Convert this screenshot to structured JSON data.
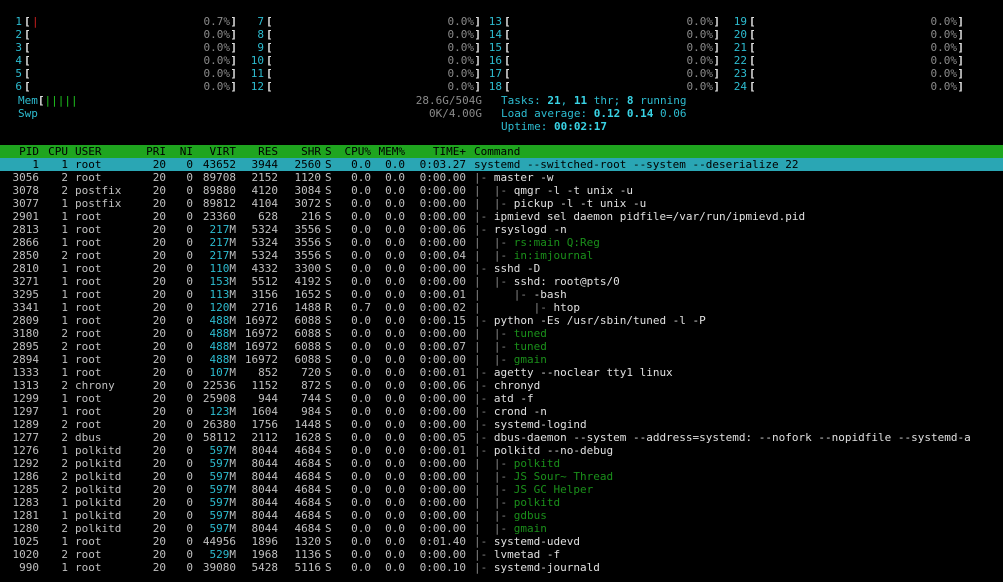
{
  "cpus": [
    {
      "n": "1",
      "bar": "|",
      "pct": "0.7%"
    },
    {
      "n": "2",
      "bar": "",
      "pct": "0.0%"
    },
    {
      "n": "3",
      "bar": "",
      "pct": "0.0%"
    },
    {
      "n": "4",
      "bar": "",
      "pct": "0.0%"
    },
    {
      "n": "5",
      "bar": "",
      "pct": "0.0%"
    },
    {
      "n": "6",
      "bar": "",
      "pct": "0.0%"
    },
    {
      "n": "7",
      "bar": "",
      "pct": "0.0%"
    },
    {
      "n": "8",
      "bar": "",
      "pct": "0.0%"
    },
    {
      "n": "9",
      "bar": "",
      "pct": "0.0%"
    },
    {
      "n": "10",
      "bar": "",
      "pct": "0.0%"
    },
    {
      "n": "11",
      "bar": "",
      "pct": "0.0%"
    },
    {
      "n": "12",
      "bar": "",
      "pct": "0.0%"
    },
    {
      "n": "13",
      "bar": "",
      "pct": "0.0%"
    },
    {
      "n": "14",
      "bar": "",
      "pct": "0.0%"
    },
    {
      "n": "15",
      "bar": "",
      "pct": "0.0%"
    },
    {
      "n": "16",
      "bar": "",
      "pct": "0.0%"
    },
    {
      "n": "17",
      "bar": "",
      "pct": "0.0%"
    },
    {
      "n": "18",
      "bar": "",
      "pct": "0.0%"
    },
    {
      "n": "19",
      "bar": "",
      "pct": "0.0%"
    },
    {
      "n": "20",
      "bar": "",
      "pct": "0.0%"
    },
    {
      "n": "21",
      "bar": "",
      "pct": "0.0%"
    },
    {
      "n": "22",
      "bar": "",
      "pct": "0.0%"
    },
    {
      "n": "23",
      "bar": "",
      "pct": "0.0%"
    },
    {
      "n": "24",
      "bar": "",
      "pct": "0.0%"
    }
  ],
  "mem": {
    "label": "Mem",
    "bars": "|||||",
    "value": "28.6G/504G"
  },
  "swp": {
    "label": "Swp",
    "value": "0K/4.00G"
  },
  "tasks": {
    "label": "Tasks:",
    "count": "21",
    "sep": ",",
    "threads": "11",
    "thr_label": "thr;",
    "running": "8",
    "running_label": "running"
  },
  "load": {
    "label": "Load average:",
    "v1": "0.12",
    "v2": "0.14",
    "v3": "0.06"
  },
  "uptime": {
    "label": "Uptime:",
    "value": "00:02:17"
  },
  "columns": [
    "PID",
    "CPU",
    "USER",
    "PRI",
    "NI",
    "VIRT",
    "RES",
    "SHR",
    "S",
    "CPU%",
    "MEM%",
    "TIME+",
    "Command"
  ],
  "processes": [
    {
      "pid": "1",
      "cpu": "1",
      "user": "root",
      "pri": "20",
      "ni": "0",
      "virt": "43652",
      "res": "3944",
      "shr": "2560",
      "s": "S",
      "cpup": "0.0",
      "memp": "0.0",
      "time": "0:03.27",
      "tree": "",
      "cmd": "systemd --switched-root --system --deserialize 22",
      "selected": true
    },
    {
      "pid": "3056",
      "cpu": "2",
      "user": "root",
      "pri": "20",
      "ni": "0",
      "virt": "89708",
      "res": "2152",
      "shr": "1120",
      "s": "S",
      "cpup": "0.0",
      "memp": "0.0",
      "time": "0:00.00",
      "tree": "|- ",
      "cmd": "master -w",
      "thread": false
    },
    {
      "pid": "3078",
      "cpu": "2",
      "user": "postfix",
      "pri": "20",
      "ni": "0",
      "virt": "89880",
      "res": "4120",
      "shr": "3084",
      "s": "S",
      "cpup": "0.0",
      "memp": "0.0",
      "time": "0:00.00",
      "tree": "|  |- ",
      "cmd": "qmgr -l -t unix -u",
      "thread": false
    },
    {
      "pid": "3077",
      "cpu": "1",
      "user": "postfix",
      "pri": "20",
      "ni": "0",
      "virt": "89812",
      "res": "4104",
      "shr": "3072",
      "s": "S",
      "cpup": "0.0",
      "memp": "0.0",
      "time": "0:00.00",
      "tree": "|  |- ",
      "cmd": "pickup -l -t unix -u",
      "thread": false
    },
    {
      "pid": "2901",
      "cpu": "1",
      "user": "root",
      "pri": "20",
      "ni": "0",
      "virt": "23360",
      "res": "628",
      "shr": "216",
      "s": "S",
      "cpup": "0.0",
      "memp": "0.0",
      "time": "0:00.00",
      "tree": "|- ",
      "cmd": "ipmievd sel daemon pidfile=/var/run/ipmievd.pid",
      "thread": false
    },
    {
      "pid": "2813",
      "cpu": "1",
      "user": "root",
      "pri": "20",
      "ni": "0",
      "virt": "217M",
      "res": "5324",
      "shr": "3556",
      "s": "S",
      "cpup": "0.0",
      "memp": "0.0",
      "time": "0:00.06",
      "tree": "|- ",
      "cmd": "rsyslogd -n",
      "thread": false
    },
    {
      "pid": "2866",
      "cpu": "1",
      "user": "root",
      "pri": "20",
      "ni": "0",
      "virt": "217M",
      "res": "5324",
      "shr": "3556",
      "s": "S",
      "cpup": "0.0",
      "memp": "0.0",
      "time": "0:00.00",
      "tree": "|  |- ",
      "cmd": "rs:main Q:Reg",
      "thread": true
    },
    {
      "pid": "2850",
      "cpu": "2",
      "user": "root",
      "pri": "20",
      "ni": "0",
      "virt": "217M",
      "res": "5324",
      "shr": "3556",
      "s": "S",
      "cpup": "0.0",
      "memp": "0.0",
      "time": "0:00.04",
      "tree": "|  |- ",
      "cmd": "in:imjournal",
      "thread": true
    },
    {
      "pid": "2810",
      "cpu": "1",
      "user": "root",
      "pri": "20",
      "ni": "0",
      "virt": "110M",
      "res": "4332",
      "shr": "3300",
      "s": "S",
      "cpup": "0.0",
      "memp": "0.0",
      "time": "0:00.00",
      "tree": "|- ",
      "cmd": "sshd -D",
      "thread": false
    },
    {
      "pid": "3271",
      "cpu": "1",
      "user": "root",
      "pri": "20",
      "ni": "0",
      "virt": "153M",
      "res": "5512",
      "shr": "4192",
      "s": "S",
      "cpup": "0.0",
      "memp": "0.0",
      "time": "0:00.00",
      "tree": "|  |- ",
      "cmd": "sshd: root@pts/0",
      "thread": false
    },
    {
      "pid": "3295",
      "cpu": "1",
      "user": "root",
      "pri": "20",
      "ni": "0",
      "virt": "113M",
      "res": "3156",
      "shr": "1652",
      "s": "S",
      "cpup": "0.0",
      "memp": "0.0",
      "time": "0:00.01",
      "tree": "|     |- ",
      "cmd": "-bash",
      "thread": false
    },
    {
      "pid": "3341",
      "cpu": "1",
      "user": "root",
      "pri": "20",
      "ni": "0",
      "virt": "120M",
      "res": "2716",
      "shr": "1488",
      "s": "R",
      "cpup": "0.7",
      "memp": "0.0",
      "time": "0:00.02",
      "tree": "|        |- ",
      "cmd": "htop",
      "thread": false
    },
    {
      "pid": "2809",
      "cpu": "1",
      "user": "root",
      "pri": "20",
      "ni": "0",
      "virt": "488M",
      "res": "16972",
      "shr": "6088",
      "s": "S",
      "cpup": "0.0",
      "memp": "0.0",
      "time": "0:00.15",
      "tree": "|- ",
      "cmd": "python -Es /usr/sbin/tuned -l -P",
      "thread": false
    },
    {
      "pid": "3180",
      "cpu": "2",
      "user": "root",
      "pri": "20",
      "ni": "0",
      "virt": "488M",
      "res": "16972",
      "shr": "6088",
      "s": "S",
      "cpup": "0.0",
      "memp": "0.0",
      "time": "0:00.00",
      "tree": "|  |- ",
      "cmd": "tuned",
      "thread": true
    },
    {
      "pid": "2895",
      "cpu": "2",
      "user": "root",
      "pri": "20",
      "ni": "0",
      "virt": "488M",
      "res": "16972",
      "shr": "6088",
      "s": "S",
      "cpup": "0.0",
      "memp": "0.0",
      "time": "0:00.07",
      "tree": "|  |- ",
      "cmd": "tuned",
      "thread": true
    },
    {
      "pid": "2894",
      "cpu": "1",
      "user": "root",
      "pri": "20",
      "ni": "0",
      "virt": "488M",
      "res": "16972",
      "shr": "6088",
      "s": "S",
      "cpup": "0.0",
      "memp": "0.0",
      "time": "0:00.00",
      "tree": "|  |- ",
      "cmd": "gmain",
      "thread": true
    },
    {
      "pid": "1333",
      "cpu": "1",
      "user": "root",
      "pri": "20",
      "ni": "0",
      "virt": "107M",
      "res": "852",
      "shr": "720",
      "s": "S",
      "cpup": "0.0",
      "memp": "0.0",
      "time": "0:00.01",
      "tree": "|- ",
      "cmd": "agetty --noclear tty1 linux",
      "thread": false
    },
    {
      "pid": "1313",
      "cpu": "2",
      "user": "chrony",
      "pri": "20",
      "ni": "0",
      "virt": "22536",
      "res": "1152",
      "shr": "872",
      "s": "S",
      "cpup": "0.0",
      "memp": "0.0",
      "time": "0:00.06",
      "tree": "|- ",
      "cmd": "chronyd",
      "thread": false
    },
    {
      "pid": "1299",
      "cpu": "1",
      "user": "root",
      "pri": "20",
      "ni": "0",
      "virt": "25908",
      "res": "944",
      "shr": "744",
      "s": "S",
      "cpup": "0.0",
      "memp": "0.0",
      "time": "0:00.00",
      "tree": "|- ",
      "cmd": "atd -f",
      "thread": false
    },
    {
      "pid": "1297",
      "cpu": "1",
      "user": "root",
      "pri": "20",
      "ni": "0",
      "virt": "123M",
      "res": "1604",
      "shr": "984",
      "s": "S",
      "cpup": "0.0",
      "memp": "0.0",
      "time": "0:00.00",
      "tree": "|- ",
      "cmd": "crond -n",
      "thread": false
    },
    {
      "pid": "1289",
      "cpu": "2",
      "user": "root",
      "pri": "20",
      "ni": "0",
      "virt": "26380",
      "res": "1756",
      "shr": "1448",
      "s": "S",
      "cpup": "0.0",
      "memp": "0.0",
      "time": "0:00.00",
      "tree": "|- ",
      "cmd": "systemd-logind",
      "thread": false
    },
    {
      "pid": "1277",
      "cpu": "2",
      "user": "dbus",
      "pri": "20",
      "ni": "0",
      "virt": "58112",
      "res": "2112",
      "shr": "1628",
      "s": "S",
      "cpup": "0.0",
      "memp": "0.0",
      "time": "0:00.05",
      "tree": "|- ",
      "cmd": "dbus-daemon --system --address=systemd: --nofork --nopidfile --systemd-a",
      "thread": false
    },
    {
      "pid": "1276",
      "cpu": "1",
      "user": "polkitd",
      "pri": "20",
      "ni": "0",
      "virt": "597M",
      "res": "8044",
      "shr": "4684",
      "s": "S",
      "cpup": "0.0",
      "memp": "0.0",
      "time": "0:00.01",
      "tree": "|- ",
      "cmd": "polkitd --no-debug",
      "thread": false
    },
    {
      "pid": "1292",
      "cpu": "2",
      "user": "polkitd",
      "pri": "20",
      "ni": "0",
      "virt": "597M",
      "res": "8044",
      "shr": "4684",
      "s": "S",
      "cpup": "0.0",
      "memp": "0.0",
      "time": "0:00.00",
      "tree": "|  |- ",
      "cmd": "polkitd",
      "thread": true
    },
    {
      "pid": "1286",
      "cpu": "2",
      "user": "polkitd",
      "pri": "20",
      "ni": "0",
      "virt": "597M",
      "res": "8044",
      "shr": "4684",
      "s": "S",
      "cpup": "0.0",
      "memp": "0.0",
      "time": "0:00.00",
      "tree": "|  |- ",
      "cmd": "JS Sour~ Thread",
      "thread": true
    },
    {
      "pid": "1285",
      "cpu": "2",
      "user": "polkitd",
      "pri": "20",
      "ni": "0",
      "virt": "597M",
      "res": "8044",
      "shr": "4684",
      "s": "S",
      "cpup": "0.0",
      "memp": "0.0",
      "time": "0:00.00",
      "tree": "|  |- ",
      "cmd": "JS GC Helper",
      "thread": true
    },
    {
      "pid": "1283",
      "cpu": "1",
      "user": "polkitd",
      "pri": "20",
      "ni": "0",
      "virt": "597M",
      "res": "8044",
      "shr": "4684",
      "s": "S",
      "cpup": "0.0",
      "memp": "0.0",
      "time": "0:00.00",
      "tree": "|  |- ",
      "cmd": "polkitd",
      "thread": true
    },
    {
      "pid": "1281",
      "cpu": "1",
      "user": "polkitd",
      "pri": "20",
      "ni": "0",
      "virt": "597M",
      "res": "8044",
      "shr": "4684",
      "s": "S",
      "cpup": "0.0",
      "memp": "0.0",
      "time": "0:00.00",
      "tree": "|  |- ",
      "cmd": "gdbus",
      "thread": true
    },
    {
      "pid": "1280",
      "cpu": "2",
      "user": "polkitd",
      "pri": "20",
      "ni": "0",
      "virt": "597M",
      "res": "8044",
      "shr": "4684",
      "s": "S",
      "cpup": "0.0",
      "memp": "0.0",
      "time": "0:00.00",
      "tree": "|  |- ",
      "cmd": "gmain",
      "thread": true
    },
    {
      "pid": "1025",
      "cpu": "1",
      "user": "root",
      "pri": "20",
      "ni": "0",
      "virt": "44956",
      "res": "1896",
      "shr": "1320",
      "s": "S",
      "cpup": "0.0",
      "memp": "0.0",
      "time": "0:01.40",
      "tree": "|- ",
      "cmd": "systemd-udevd",
      "thread": false
    },
    {
      "pid": "1020",
      "cpu": "2",
      "user": "root",
      "pri": "20",
      "ni": "0",
      "virt": "529M",
      "res": "1968",
      "shr": "1136",
      "s": "S",
      "cpup": "0.0",
      "memp": "0.0",
      "time": "0:00.00",
      "tree": "|- ",
      "cmd": "lvmetad -f",
      "thread": false
    },
    {
      "pid": "990",
      "cpu": "1",
      "user": "root",
      "pri": "20",
      "ni": "0",
      "virt": "39080",
      "res": "5428",
      "shr": "5116",
      "s": "S",
      "cpup": "0.0",
      "memp": "0.0",
      "time": "0:00.10",
      "tree": "|- ",
      "cmd": "systemd-journald",
      "thread": false
    }
  ]
}
